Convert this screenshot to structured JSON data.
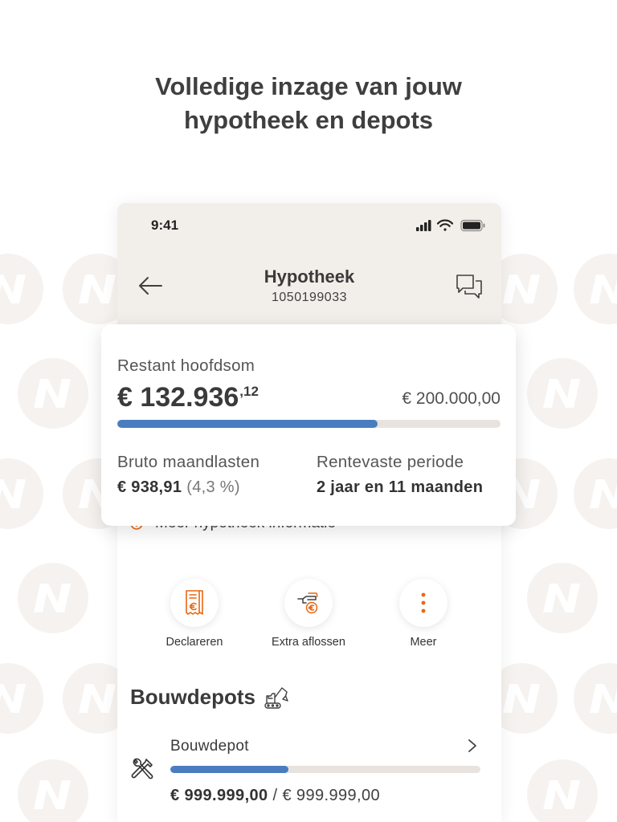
{
  "headline": "Volledige inzage van jouw hypotheek en depots",
  "status_bar": {
    "time": "9:41",
    "icons": [
      "signal-icon",
      "wifi-icon",
      "battery-icon"
    ]
  },
  "header": {
    "title": "Hypotheek",
    "subtitle": "1050199033",
    "back_icon": "arrow-left-icon",
    "chat_icon": "chat-bubbles-icon"
  },
  "summary": {
    "label": "Restant hoofdsom",
    "amount": "€ 132.936",
    "amount_cents": ",12",
    "total": "€ 200.000,00",
    "progress": 0.68,
    "monthly": {
      "label": "Bruto maandlasten",
      "value": "€ 938,91",
      "rate": "(4,3 %)"
    },
    "fixed_rate_period": {
      "label": "Rentevaste periode",
      "value": "2 jaar en 11 maanden"
    }
  },
  "more_info": {
    "label": "Meer hypotheek informatie",
    "icon": "info-icon"
  },
  "actions": [
    {
      "label": "Declareren",
      "icon": "receipt-euro-icon"
    },
    {
      "label": "Extra aflossen",
      "icon": "hand-euro-coin-icon"
    },
    {
      "label": "Meer",
      "icon": "more-vertical-icon"
    }
  ],
  "depots": {
    "heading": "Bouwdepots",
    "heading_icon": "excavator-icon",
    "items": [
      {
        "name": "Bouwdepot",
        "icon": "tools-icon",
        "amount": "€ 999.999,00",
        "separator": " / ",
        "total": "€ 999.999,00",
        "progress": 0.38
      }
    ]
  },
  "colors": {
    "accent": "#ea650d",
    "progress": "#4a7dc0",
    "track": "#e8e3de",
    "header_bg": "#f2eeea",
    "text": "#404040"
  }
}
